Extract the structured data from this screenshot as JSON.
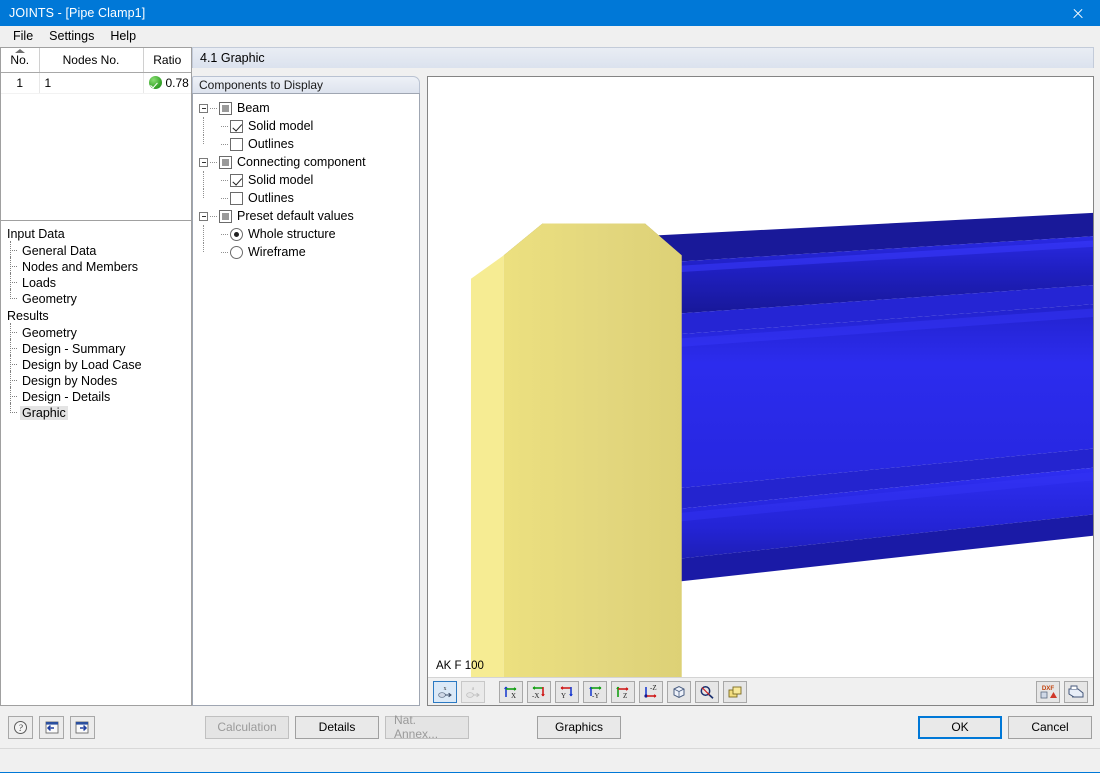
{
  "window": {
    "title": "JOINTS - [Pipe Clamp1]",
    "close_label": "close-window"
  },
  "menubar": {
    "items": [
      {
        "label": "File"
      },
      {
        "label": "Settings"
      },
      {
        "label": "Help"
      }
    ]
  },
  "result_grid": {
    "columns": [
      "No.",
      "Nodes No.",
      "Ratio"
    ],
    "sort_column": "No.",
    "rows": [
      {
        "no": "1",
        "nodes_no": "1",
        "ratio": "0.78",
        "status": "ok"
      }
    ]
  },
  "navigator": {
    "groups": [
      {
        "label": "Input Data",
        "items": [
          {
            "label": "General Data",
            "selected": false
          },
          {
            "label": "Nodes and Members",
            "selected": false
          },
          {
            "label": "Loads",
            "selected": false
          },
          {
            "label": "Geometry",
            "selected": false
          }
        ]
      },
      {
        "label": "Results",
        "items": [
          {
            "label": "Geometry",
            "selected": false
          },
          {
            "label": "Design - Summary",
            "selected": false
          },
          {
            "label": "Design by Load Case",
            "selected": false
          },
          {
            "label": "Design by Nodes",
            "selected": false
          },
          {
            "label": "Design - Details",
            "selected": false
          },
          {
            "label": "Graphic",
            "selected": true
          }
        ]
      }
    ]
  },
  "section": {
    "title": "4.1 Graphic"
  },
  "components_panel": {
    "title": "Components to Display",
    "nodes": [
      {
        "label": "Beam",
        "state": "indeterminate",
        "children": [
          {
            "label": "Solid model",
            "type": "checkbox",
            "checked": true
          },
          {
            "label": "Outlines",
            "type": "checkbox",
            "checked": false
          }
        ]
      },
      {
        "label": "Connecting component",
        "state": "indeterminate",
        "children": [
          {
            "label": "Solid model",
            "type": "checkbox",
            "checked": true
          },
          {
            "label": "Outlines",
            "type": "checkbox",
            "checked": false
          }
        ]
      },
      {
        "label": "Preset default values",
        "state": "indeterminate",
        "children": [
          {
            "label": "Whole structure",
            "type": "radio",
            "checked": true
          },
          {
            "label": "Wireframe",
            "type": "radio",
            "checked": false
          }
        ]
      }
    ]
  },
  "graphic": {
    "caption": "AK F 100",
    "colors": {
      "plate_front": "#e2d682",
      "plate_side": "#f6eb92",
      "plate_top": "#b0a44f",
      "plate_bottom": "#c5b95f",
      "beam_dark": "#161694",
      "beam_mid": "#2020c8",
      "beam_bright": "#2c2cf0",
      "background": "#ffffff"
    },
    "toolbar": {
      "left_buttons": [
        {
          "name": "render-solid",
          "label": "x",
          "selected": true,
          "enabled": true
        },
        {
          "name": "render-wire",
          "label": "a",
          "selected": false,
          "enabled": false
        },
        {
          "name": "view-x",
          "label": "X",
          "selected": false,
          "enabled": true
        },
        {
          "name": "view-neg-x",
          "label": "-X",
          "selected": false,
          "enabled": true
        },
        {
          "name": "view-y",
          "label": "Y",
          "selected": false,
          "enabled": true
        },
        {
          "name": "view-neg-y",
          "label": "-Y",
          "selected": false,
          "enabled": true
        },
        {
          "name": "view-z",
          "label": "Z",
          "selected": false,
          "enabled": true
        },
        {
          "name": "view-neg-z",
          "label": "-Z",
          "selected": false,
          "enabled": true
        },
        {
          "name": "view-isometric",
          "label": "",
          "selected": false,
          "enabled": true
        },
        {
          "name": "zoom-tool",
          "label": "",
          "selected": false,
          "enabled": true
        },
        {
          "name": "layers-tool",
          "label": "",
          "selected": false,
          "enabled": true
        }
      ],
      "right_buttons": [
        {
          "name": "dxf-export",
          "label": "DXF"
        },
        {
          "name": "print",
          "label": ""
        }
      ]
    }
  },
  "footer": {
    "icon_buttons": [
      {
        "name": "help",
        "label": "?"
      },
      {
        "name": "previous-module",
        "label": "<"
      },
      {
        "name": "next-module",
        "label": ">"
      }
    ],
    "buttons": [
      {
        "name": "calculation",
        "label": "Calculation",
        "enabled": false
      },
      {
        "name": "details",
        "label": "Details",
        "enabled": true
      },
      {
        "name": "nat-annex",
        "label": "Nat. Annex...",
        "enabled": false
      },
      {
        "name": "graphics",
        "label": "Graphics",
        "enabled": true
      }
    ],
    "ok_label": "OK",
    "cancel_label": "Cancel"
  }
}
